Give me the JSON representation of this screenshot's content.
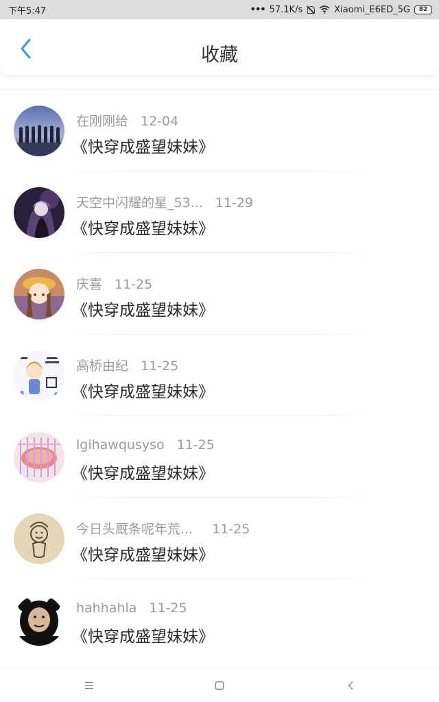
{
  "status_bar": {
    "time": "下午5:47",
    "network_speed": "57.1K/s",
    "wifi_name": "Xiaomi_E6ED_5G",
    "battery_level": "82"
  },
  "header": {
    "title": "收藏",
    "back_icon": "chevron-left-icon"
  },
  "favorites": [
    {
      "user": "在刚刚给",
      "date": "12-04",
      "book": "《快穿成盛望妹妹》",
      "avatar_icon": "silhouettes-avatar"
    },
    {
      "user": "天空中闪耀的星_53...",
      "date": "11-29",
      "book": "《快穿成盛望妹妹》",
      "avatar_icon": "anime-girl-dark-avatar"
    },
    {
      "user": "庆喜",
      "date": "11-25",
      "book": "《快穿成盛望妹妹》",
      "avatar_icon": "anime-girl-hat-avatar"
    },
    {
      "user": "高桥由纪",
      "date": "11-25",
      "book": "《快穿成盛望妹妹》",
      "avatar_icon": "cartoon-girl-avatar"
    },
    {
      "user": "lgihawqusyso",
      "date": "11-25",
      "book": "《快穿成盛望妹妹》",
      "avatar_icon": "food-grill-avatar"
    },
    {
      "user": "今日头厩条呢年荒...",
      "date": "11-25",
      "book": "《快穿成盛望妹妹》",
      "avatar_icon": "sketch-doodle-avatar"
    },
    {
      "user": "hahhahla",
      "date": "11-25",
      "book": "《快穿成盛望妹妹》",
      "avatar_icon": "panda-meme-avatar"
    }
  ],
  "nav": {
    "menu_icon": "menu-icon",
    "home_icon": "home-square-icon",
    "back_icon": "back-triangle-icon"
  },
  "colors": {
    "accent": "#2a9be8",
    "status_bar_bg": "#dcdcdc",
    "meta_text": "#9a9a9a",
    "title_text": "#333333"
  }
}
